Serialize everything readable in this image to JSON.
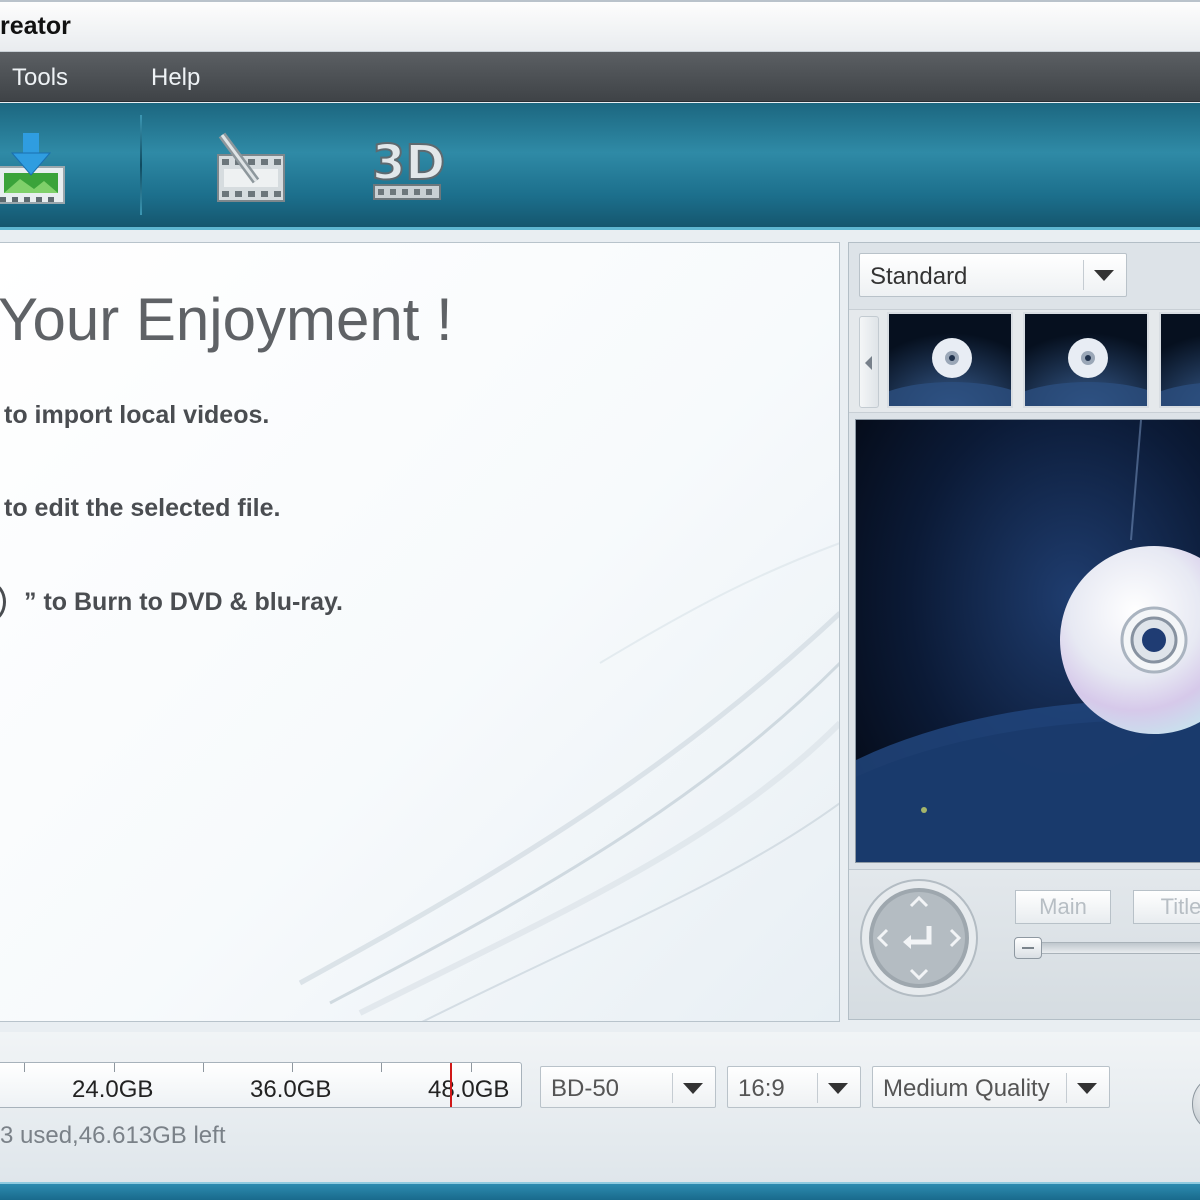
{
  "window": {
    "title": "reator"
  },
  "menu": {
    "items": [
      "Tools",
      "Help"
    ]
  },
  "toolbar": {
    "buttons": [
      {
        "name": "import",
        "icon": "import-video-icon"
      },
      {
        "name": "edit",
        "icon": "edit-video-icon"
      },
      {
        "name": "3d",
        "icon": "3d-icon",
        "label": "3D"
      }
    ]
  },
  "main": {
    "heading": "Your Enjoyment !",
    "steps": [
      " to import local videos.",
      " to edit the selected file.",
      "” to Burn to DVD & blu-ray."
    ]
  },
  "side": {
    "menu_template_select": {
      "value": "Standard"
    },
    "thumbnails": [
      "disc-theme-1",
      "disc-theme-2",
      "disc-theme-3"
    ],
    "player": {
      "main_label": "Main",
      "title_label": "Title"
    }
  },
  "bottom": {
    "capacity_labels": [
      "24.0GB",
      "36.0GB",
      "48.0GB"
    ],
    "usage_text": "3 used,46.613GB left",
    "disc_type": "BD-50",
    "aspect_ratio": "16:9",
    "quality": "Medium Quality"
  },
  "colors": {
    "toolbar": "#2f8aa6",
    "menubar": "#4a4e52",
    "limit_marker": "#d01818"
  }
}
